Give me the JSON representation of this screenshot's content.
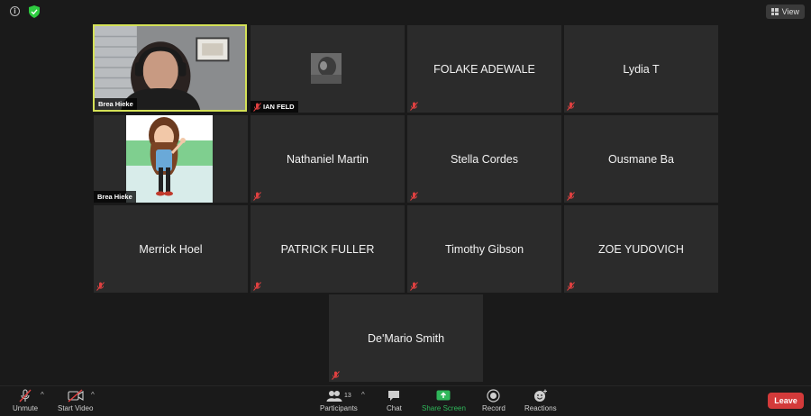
{
  "topbar": {
    "view_label": "View"
  },
  "participants": {
    "self_video_name": "Brea Hieke",
    "ian_name": "IAN FELD",
    "avatar_name": "Brea Hieke",
    "tiles": [
      "FOLAKE ADEWALE",
      "Lydia T",
      "Nathaniel Martin",
      "Stella Cordes",
      "Ousmane Ba",
      "Merrick Hoel",
      "PATRICK FULLER",
      "Timothy Gibson",
      "ZOE YUDOVICH",
      "De'Mario Smith"
    ]
  },
  "toolbar": {
    "unmute": "Unmute",
    "start_video": "Start Video",
    "participants": "Participants",
    "participant_count": "13",
    "chat": "Chat",
    "share_screen": "Share Screen",
    "record": "Record",
    "reactions": "Reactions",
    "leave": "Leave"
  },
  "colors": {
    "active_speaker_border": "#d4e157",
    "share_screen": "#2fb75a",
    "leave": "#d33a3a",
    "mute_icon": "#e04040"
  }
}
